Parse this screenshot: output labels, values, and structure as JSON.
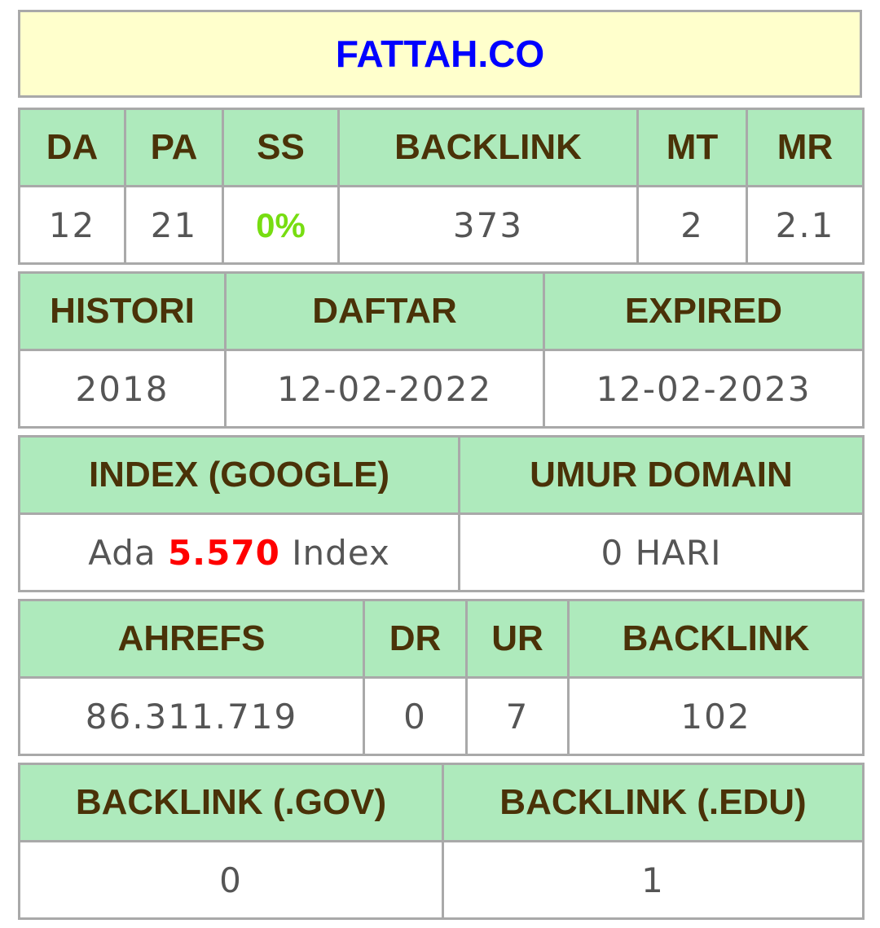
{
  "domain": "FATTAH.CO",
  "colors": {
    "title_text": "#0000ff",
    "title_bg": "#ffffcc",
    "header_bg": "#aeeabc",
    "header_text": "#4a3208",
    "ss_value": "#77dd11",
    "index_count": "#ff0000"
  },
  "moz": {
    "headers": [
      "DA",
      "PA",
      "SS",
      "BACKLINK",
      "MT",
      "MR"
    ],
    "values": {
      "da": "12",
      "pa": "21",
      "ss": "0%",
      "backlink": "373",
      "mt": "2",
      "mr": "2.1"
    }
  },
  "history": {
    "headers": [
      "HISTORI",
      "DAFTAR",
      "EXPIRED"
    ],
    "values": {
      "histori": "2018",
      "daftar": "12-02-2022",
      "expired": "12-02-2023"
    }
  },
  "index": {
    "headers": [
      "INDEX (GOOGLE)",
      "UMUR DOMAIN"
    ],
    "google_prefix": "Ada",
    "google_count": "5.570",
    "google_suffix": "Index",
    "umur_domain": "0 HARI"
  },
  "ahrefs": {
    "headers": [
      "AHREFS",
      "DR",
      "UR",
      "BACKLINK"
    ],
    "values": {
      "ahrefs": "86.311.719",
      "dr": "0",
      "ur": "7",
      "backlink": "102"
    }
  },
  "edu_gov": {
    "headers": [
      "BACKLINK (.GOV)",
      "BACKLINK (.EDU)"
    ],
    "values": {
      "gov": "0",
      "edu": "1"
    }
  }
}
